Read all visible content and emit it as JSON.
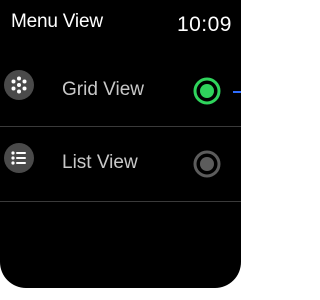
{
  "header": {
    "title": "Menu View",
    "time": "10:09"
  },
  "menu": {
    "items": [
      {
        "label": "Grid View",
        "icon": "grid-dots-icon",
        "selected": true
      },
      {
        "label": "List View",
        "icon": "list-icon",
        "selected": false
      }
    ]
  },
  "colors": {
    "background": "#000000",
    "text": "#ffffff",
    "label": "#c8c8c8",
    "icon_bg": "#4a4a4a",
    "radio_selected": "#2fd45c",
    "radio_unselected": "#5c5c5c",
    "divider": "#3a3a3a",
    "accent_edge": "#2f6dff"
  }
}
